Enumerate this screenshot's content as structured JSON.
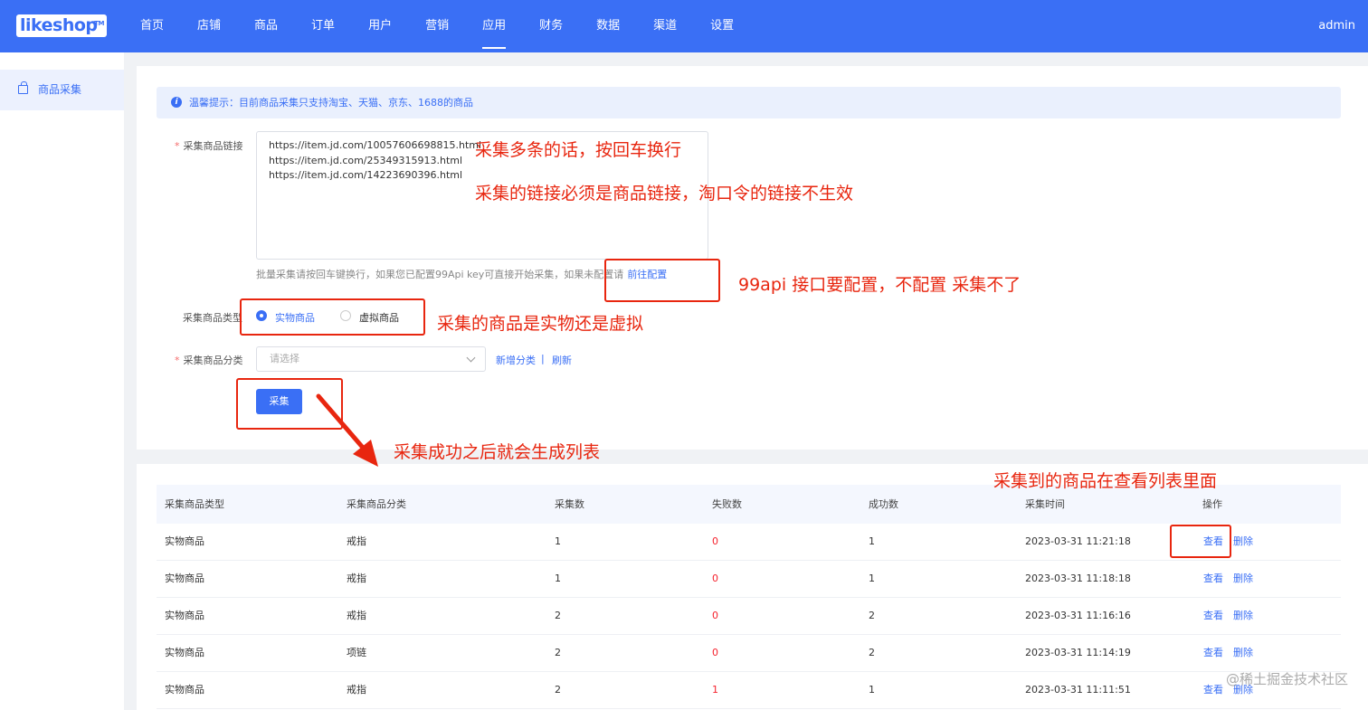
{
  "header": {
    "logo": "likeshop",
    "logo_tm": "TM",
    "nav": [
      "首页",
      "店铺",
      "商品",
      "订单",
      "用户",
      "营销",
      "应用",
      "财务",
      "数据",
      "渠道",
      "设置"
    ],
    "active_nav": "应用",
    "user": "admin"
  },
  "sidebar": {
    "items": [
      {
        "label": "商品采集"
      }
    ]
  },
  "tip": {
    "text": "温馨提示：目前商品采集只支持淘宝、天猫、京东、1688的商品"
  },
  "form": {
    "link_label": "采集商品链接",
    "link_value": [
      "https://item.jd.com/10057606698815.html",
      "https://item.jd.com/25349315913.html",
      "https://item.jd.com/14223690396.html"
    ],
    "help_text": "批量采集请按回车键换行，如果您已配置99Api key可直接开始采集，如果未配置请",
    "help_link": "前往配置",
    "type_label": "采集商品类型",
    "type_options": [
      "实物商品",
      "虚拟商品"
    ],
    "type_selected": "实物商品",
    "category_label": "采集商品分类",
    "category_placeholder": "请选择",
    "add_category": "新增分类",
    "divider": "|",
    "refresh": "刷新",
    "submit": "采集"
  },
  "table": {
    "headers": [
      "采集商品类型",
      "采集商品分类",
      "采集数",
      "失败数",
      "成功数",
      "采集时间",
      "操作"
    ],
    "rows": [
      [
        "实物商品",
        "戒指",
        "1",
        "0",
        "1",
        "2023-03-31 11:21:18"
      ],
      [
        "实物商品",
        "戒指",
        "1",
        "0",
        "1",
        "2023-03-31 11:18:18"
      ],
      [
        "实物商品",
        "戒指",
        "2",
        "0",
        "2",
        "2023-03-31 11:16:16"
      ],
      [
        "实物商品",
        "项链",
        "2",
        "0",
        "2",
        "2023-03-31 11:14:19"
      ],
      [
        "实物商品",
        "戒指",
        "2",
        "1",
        "1",
        "2023-03-31 11:11:51"
      ]
    ],
    "action_view": "查看",
    "action_delete": "删除"
  },
  "annotations": {
    "a1": "采集多条的话，按回车换行",
    "a2": "采集的链接必须是商品链接，淘口令的链接不生效",
    "a3": "99api 接口要配置，不配置 采集不了",
    "a4": "采集的商品是实物还是虚拟",
    "a5": "采集成功之后就会生成列表",
    "a6": "采集到的商品在查看列表里面",
    "color": "#e8260f"
  },
  "watermark": "@稀土掘金技术社区",
  "colors": {
    "primary": "#3a6ff5",
    "danger": "#f5222d"
  }
}
